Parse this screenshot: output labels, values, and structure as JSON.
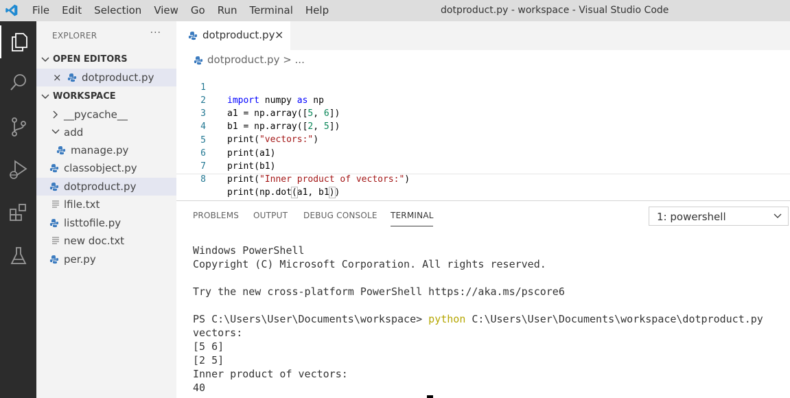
{
  "window": {
    "title": "dotproduct.py - workspace - Visual Studio Code",
    "menu": [
      "File",
      "Edit",
      "Selection",
      "View",
      "Go",
      "Run",
      "Terminal",
      "Help"
    ]
  },
  "activity_bar": {
    "icons": [
      "files-icon",
      "search-icon",
      "source-control-icon",
      "run-debug-icon",
      "extensions-icon",
      "testing-icon"
    ],
    "active": "files-icon"
  },
  "sidebar": {
    "header": "EXPLORER",
    "more": "···",
    "open_editors": {
      "title": "OPEN EDITORS",
      "items": [
        {
          "label": "dotproduct.py",
          "close": "×"
        }
      ]
    },
    "workspace": {
      "title": "WORKSPACE",
      "items": [
        {
          "label": "__pycache__",
          "type": "folder",
          "expanded": false
        },
        {
          "label": "add",
          "type": "folder",
          "expanded": true
        },
        {
          "label": "manage.py",
          "type": "python"
        },
        {
          "label": "classobject.py",
          "type": "python"
        },
        {
          "label": "dotproduct.py",
          "type": "python",
          "selected": true
        },
        {
          "label": "lfile.txt",
          "type": "text"
        },
        {
          "label": "listtofile.py",
          "type": "python"
        },
        {
          "label": "new doc.txt",
          "type": "text"
        },
        {
          "label": "per.py",
          "type": "python"
        }
      ]
    }
  },
  "editor": {
    "tab": {
      "label": "dotproduct.py",
      "close": "×"
    },
    "breadcrumb": "dotproduct.py > ...",
    "line_numbers": [
      "1",
      "2",
      "3",
      "4",
      "5",
      "6",
      "7",
      "8"
    ],
    "lines": [
      "import numpy as np",
      "a1 = np.array([5, 6])",
      "b1 = np.array([2, 5])",
      "print(\"vectors:\")",
      "print(a1)",
      "print(b1)",
      "print(\"Inner product of vectors:\")",
      "print(np.dot(a1, b1))"
    ]
  },
  "panel": {
    "tabs": [
      "PROBLEMS",
      "OUTPUT",
      "DEBUG CONSOLE",
      "TERMINAL"
    ],
    "active_tab": "TERMINAL",
    "terminal_select": "1: powershell",
    "terminal": {
      "lines": [
        "Windows PowerShell",
        "Copyright (C) Microsoft Corporation. All rights reserved.",
        "",
        "Try the new cross-platform PowerShell https://aka.ms/pscore6",
        "",
        "",
        "vectors:",
        "[5 6]",
        "[2 5]",
        "Inner product of vectors:",
        "40"
      ],
      "prompt": "PS C:\\Users\\User\\Documents\\workspace> ",
      "command": "python",
      "command_arg": " C:\\Users\\User\\Documents\\workspace\\dotproduct.py"
    }
  },
  "colors": {
    "python_icon": "#3b7bbf",
    "keyword": "#0000ff",
    "string": "#a31515",
    "number": "#098658",
    "line_number": "#237893",
    "terminal_command": "#b5a600"
  }
}
